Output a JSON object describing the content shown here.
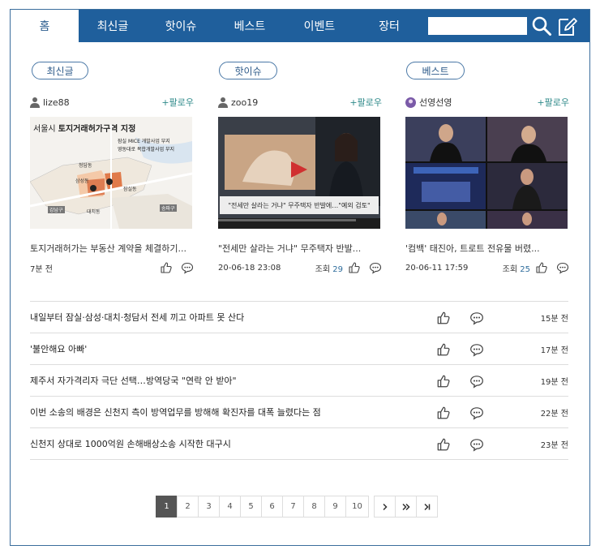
{
  "nav": {
    "tabs": [
      {
        "label": "홈"
      },
      {
        "label": "최신글"
      },
      {
        "label": "핫이슈"
      },
      {
        "label": "베스트"
      },
      {
        "label": "이벤트"
      },
      {
        "label": "장터"
      }
    ],
    "search_value": "",
    "icons": [
      "search-icon",
      "write-icon"
    ],
    "colors": {
      "nav_bg": "#1f5f9c",
      "accent": "#2e6c9c",
      "follow": "#2f8a8a"
    }
  },
  "sections": [
    {
      "pill": "최신글",
      "user": "lize88",
      "follow": "+팔로우",
      "map_title_prefix": "서울시 ",
      "map_title_bold": "토지거래허가구역 지정",
      "map_legend": [
        "잠실 MICE 개발사업 부지",
        "영동대로 복합개발사업 부지"
      ],
      "map_labels": [
        "청담동",
        "삼성동",
        "잠실동",
        "대치동",
        "강남구",
        "송파구"
      ],
      "title": "토지거래허가는 부동산 계약을 체결하기...",
      "time": "7분 전",
      "views_label": "",
      "views": ""
    },
    {
      "pill": "핫이슈",
      "user": "zoo19",
      "follow": "+팔로우",
      "overlay_caption": "\"전세만 살라는 거냐\" 무주택자 반발에…\"예외 검토\"",
      "title": "\"전세만 살라는 거냐\" 무주택자 반발...",
      "time": "20-06-18 23:08",
      "views_label": "조회",
      "views": "29"
    },
    {
      "pill": "베스트",
      "user": "선영선영",
      "follow": "+팔로우",
      "title": "'컴백' 태진아, 트로트 전유물 버렸...",
      "time": "20-06-11 17:59",
      "views_label": "조회",
      "views": "25"
    }
  ],
  "list": [
    {
      "title": "내일부터 잠실·삼성·대치·청담서 전세 끼고 아파트 못 산다",
      "time": "15분 전"
    },
    {
      "title": "'불안해요 아빠'",
      "time": "17분 전"
    },
    {
      "title": "제주서 자가격리자 극단 선택…방역당국 \"연락 안 받아\"",
      "time": "19분 전"
    },
    {
      "title": "이번 소송의 배경은 신천지 측이 방역업무를 방해해 확진자를 대폭 늘렸다는 점",
      "time": "22분 전"
    },
    {
      "title": "신천지 상대로 1000억원 손해배상소송 시작한 대구시",
      "time": "23분 전"
    }
  ],
  "pagination": {
    "pages": [
      "1",
      "2",
      "3",
      "4",
      "5",
      "6",
      "7",
      "8",
      "9",
      "10"
    ],
    "current": "1",
    "arrows": [
      "›",
      "»",
      "›|"
    ]
  }
}
